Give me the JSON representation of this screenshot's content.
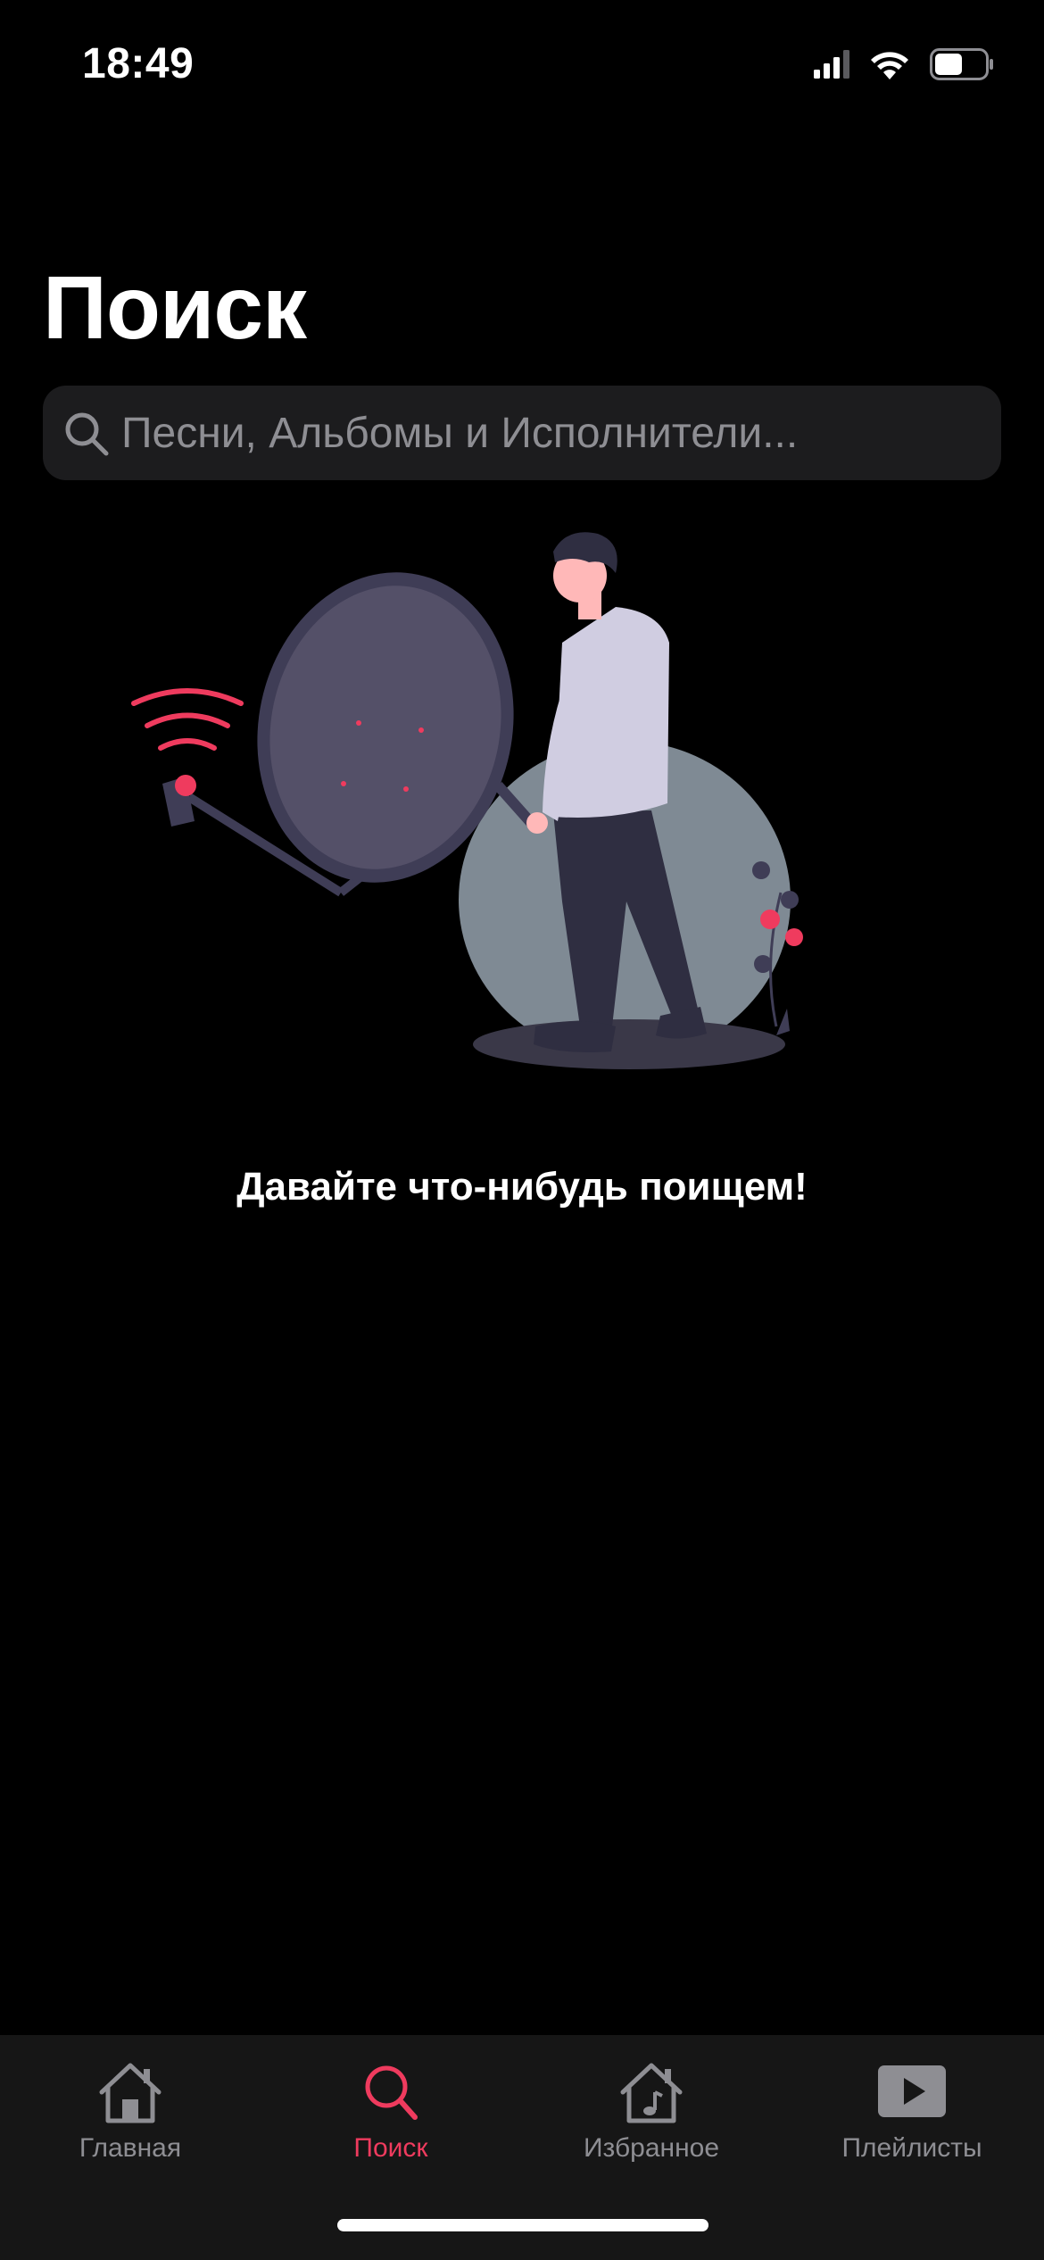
{
  "status_bar": {
    "time": "18:49",
    "icons": [
      "signal-icon",
      "wifi-icon",
      "battery-icon"
    ]
  },
  "page": {
    "title": "Поиск"
  },
  "search": {
    "placeholder": "Песни, Альбомы и Исполнители...",
    "value": "",
    "icon": "search-icon"
  },
  "empty_state": {
    "illustration": "person-with-satellite-dish-illustration",
    "message": "Давайте что-нибудь поищем!"
  },
  "tab_bar": {
    "tabs": [
      {
        "label": "Главная",
        "icon": "home-icon",
        "active": false
      },
      {
        "label": "Поиск",
        "icon": "search-icon",
        "active": true
      },
      {
        "label": "Избранное",
        "icon": "favorites-music-home-icon",
        "active": false
      },
      {
        "label": "Плейлисты",
        "icon": "play-icon",
        "active": false
      }
    ]
  },
  "colors": {
    "background": "#000000",
    "accent": "#ef3b5e",
    "inactive": "#8e8e93",
    "search_bg": "#1c1c1e",
    "tab_bar_bg": "#161616"
  }
}
